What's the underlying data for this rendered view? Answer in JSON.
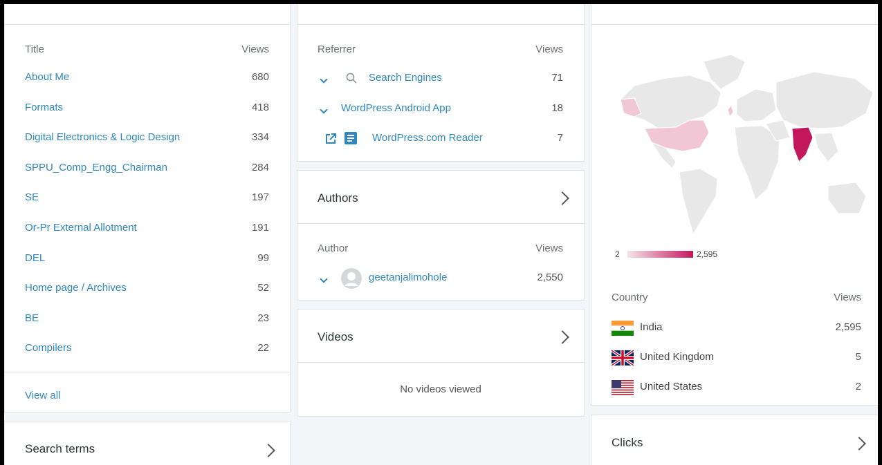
{
  "posts": {
    "col_title": "Title",
    "col_views": "Views",
    "rows": [
      {
        "title": "About Me",
        "views": "680"
      },
      {
        "title": "Formats",
        "views": "418"
      },
      {
        "title": "Digital Electronics & Logic Design",
        "views": "334"
      },
      {
        "title": "SPPU_Comp_Engg_Chairman",
        "views": "284"
      },
      {
        "title": "SE",
        "views": "197"
      },
      {
        "title": "Or-Pr External Allotment",
        "views": "191"
      },
      {
        "title": "DEL",
        "views": "99"
      },
      {
        "title": "Home page / Archives",
        "views": "52"
      },
      {
        "title": "BE",
        "views": "23"
      },
      {
        "title": "Compilers",
        "views": "22"
      }
    ],
    "view_all": "View all"
  },
  "search_terms": {
    "label": "Search terms"
  },
  "referrers": {
    "col_title": "Referrer",
    "col_views": "Views",
    "rows": [
      {
        "label": "Search Engines",
        "views": "71",
        "icon": "search-icon"
      },
      {
        "label": "WordPress Android App",
        "views": "18"
      },
      {
        "label": "WordPress.com Reader",
        "views": "7",
        "icon": "reader-icon"
      }
    ]
  },
  "authors": {
    "label": "Authors",
    "col_title": "Author",
    "col_views": "Views",
    "rows": [
      {
        "name": "geetanjalimohole",
        "views": "2,550"
      }
    ]
  },
  "videos": {
    "label": "Videos",
    "empty": "No videos viewed"
  },
  "countries": {
    "legend_min": "2",
    "legend_max": "2,595",
    "col_title": "Country",
    "col_views": "Views",
    "rows": [
      {
        "name": "India",
        "views": "2,595"
      },
      {
        "name": "United Kingdom",
        "views": "5"
      },
      {
        "name": "United States",
        "views": "2"
      }
    ],
    "colors": {
      "high": "#c2185b",
      "low": "#f1c7d6",
      "empty": "#e8e8e8"
    }
  },
  "clicks": {
    "label": "Clicks"
  }
}
